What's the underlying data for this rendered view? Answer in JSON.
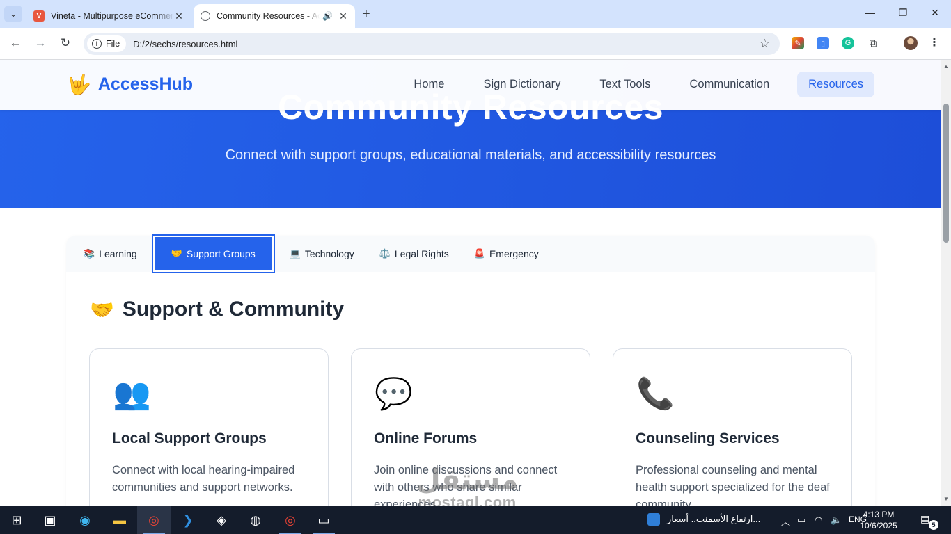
{
  "browser": {
    "tabs": [
      {
        "title": "Vineta - Multipurpose eCommerce",
        "favicon": "vineta-logo-icon",
        "active": false
      },
      {
        "title": "Community Resources - AccessHub",
        "favicon": "globe-icon",
        "active": true,
        "audio": true
      }
    ],
    "url_chip": "File",
    "url": "D:/2/sechs/resources.html"
  },
  "site": {
    "brand_icon": "🤟",
    "brand_name": "AccessHub",
    "nav": [
      "Home",
      "Sign Dictionary",
      "Text Tools",
      "Communication",
      "Resources"
    ],
    "active_nav": "Resources"
  },
  "hero": {
    "title": "Community Resources",
    "subtitle": "Connect with support groups, educational materials, and accessibility resources"
  },
  "resource_tabs": [
    {
      "icon": "📚",
      "label": "Learning"
    },
    {
      "icon": "🤝",
      "label": "Support Groups",
      "active": true
    },
    {
      "icon": "💻",
      "label": "Technology"
    },
    {
      "icon": "⚖️",
      "label": "Legal Rights"
    },
    {
      "icon": "🚨",
      "label": "Emergency"
    }
  ],
  "section": {
    "icon": "🤝",
    "title": "Support & Community"
  },
  "cards": [
    {
      "icon": "👥",
      "title": "Local Support Groups",
      "text": "Connect with local hearing-impaired communities and support networks."
    },
    {
      "icon": "💬",
      "title": "Online Forums",
      "text": "Join online discussions and connect with others who share similar experiences."
    },
    {
      "icon": "📞",
      "title": "Counseling Services",
      "text": "Professional counseling and mental health support specialized for the deaf community."
    }
  ],
  "watermark": {
    "arabic": "مستقل",
    "latin": "mostaql.com"
  },
  "taskbar": {
    "news": "ارتفاع الأسمنت.. أسعار...",
    "language": "ENG",
    "time": "4:13 PM",
    "date": "10/6/2025",
    "notifications": "5"
  },
  "colors": {
    "primary": "#2563eb",
    "hero_bg": "#1d4ed8",
    "tab_strip": "#d3e3fd",
    "taskbar": "#141c2b"
  }
}
